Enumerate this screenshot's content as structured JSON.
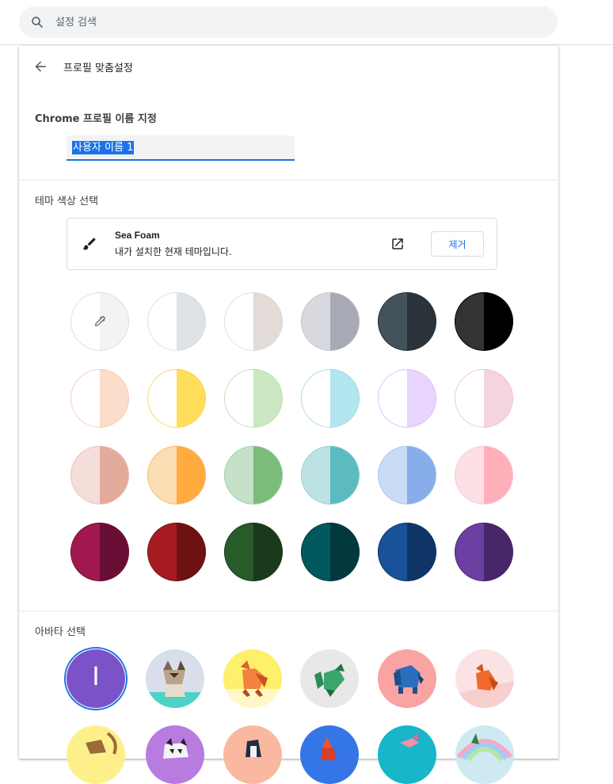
{
  "search": {
    "placeholder": "설정 검색"
  },
  "header": {
    "title": "프로필 맞춤설정"
  },
  "profile_name": {
    "label": "Chrome 프로필 이름 지정",
    "value": "사용자 이름 1"
  },
  "theme": {
    "label": "테마 색상 선택",
    "current_name": "Sea Foam",
    "current_desc": "내가 설치한 현재 테마입니다.",
    "remove_label": "제거",
    "swatches": [
      [
        "#ffffff",
        "#f1f3f4"
      ],
      [
        "#ffffff",
        "#dee1e6"
      ],
      [
        "#ffffff",
        "#e3dbd8"
      ],
      [
        "#d8d9de",
        "#a7aab5"
      ],
      [
        "#44525b",
        "#2a3339"
      ],
      [
        "#333333",
        "#000000"
      ],
      [
        "#ffffff",
        "#fcdccb"
      ],
      [
        "#ffffff",
        "#fede5b"
      ],
      [
        "#ffffff",
        "#cbe8c3"
      ],
      [
        "#ffffff",
        "#b3e6ef"
      ],
      [
        "#ffffff",
        "#e8d5fe"
      ],
      [
        "#ffffff",
        "#f5d4e1"
      ],
      [
        "#f4ded9",
        "#e2ab9b"
      ],
      [
        "#fdddb4",
        "#ffab40"
      ],
      [
        "#c5e1c9",
        "#7bbc7a"
      ],
      [
        "#bce2e4",
        "#5bbbbf"
      ],
      [
        "#cadcf5",
        "#87aee8"
      ],
      [
        "#fde0e6",
        "#ffafba"
      ],
      [
        "#a0184e",
        "#6a0d34"
      ],
      [
        "#a51b21",
        "#6c1212"
      ],
      [
        "#275b2a",
        "#1a3a1c"
      ],
      [
        "#02585f",
        "#01393e"
      ],
      [
        "#1a5299",
        "#0e3566"
      ],
      [
        "#6c3fa2",
        "#472769"
      ]
    ],
    "swatch_borders": [
      "#dadce0",
      "#dadce0",
      "#dadce0",
      "#c0c2c8",
      "#2a3339",
      "#000000",
      "#f8c9b0",
      "#fcd34d",
      "#b7dfad",
      "#9adbe8",
      "#d6bdfb",
      "#efbfd2",
      "#e7c0b5",
      "#f7b668",
      "#9fcca2",
      "#8fd0d3",
      "#a9c4ee",
      "#fbc4ce",
      "#6a0d34",
      "#6c1212",
      "#1a3a1c",
      "#01393e",
      "#0e3566",
      "#472769"
    ]
  },
  "avatar": {
    "label": "아바타 선택",
    "initial": "I",
    "accent": "#1a73e8",
    "items": [
      "initial-avatar",
      "cat-avatar",
      "fox-avatar",
      "dragon-avatar",
      "elephant-avatar",
      "fox-pink-avatar",
      "monkey-avatar",
      "panda-avatar",
      "penguin-avatar",
      "bird-avatar",
      "rabbit-avatar",
      "unicorn-avatar"
    ]
  }
}
